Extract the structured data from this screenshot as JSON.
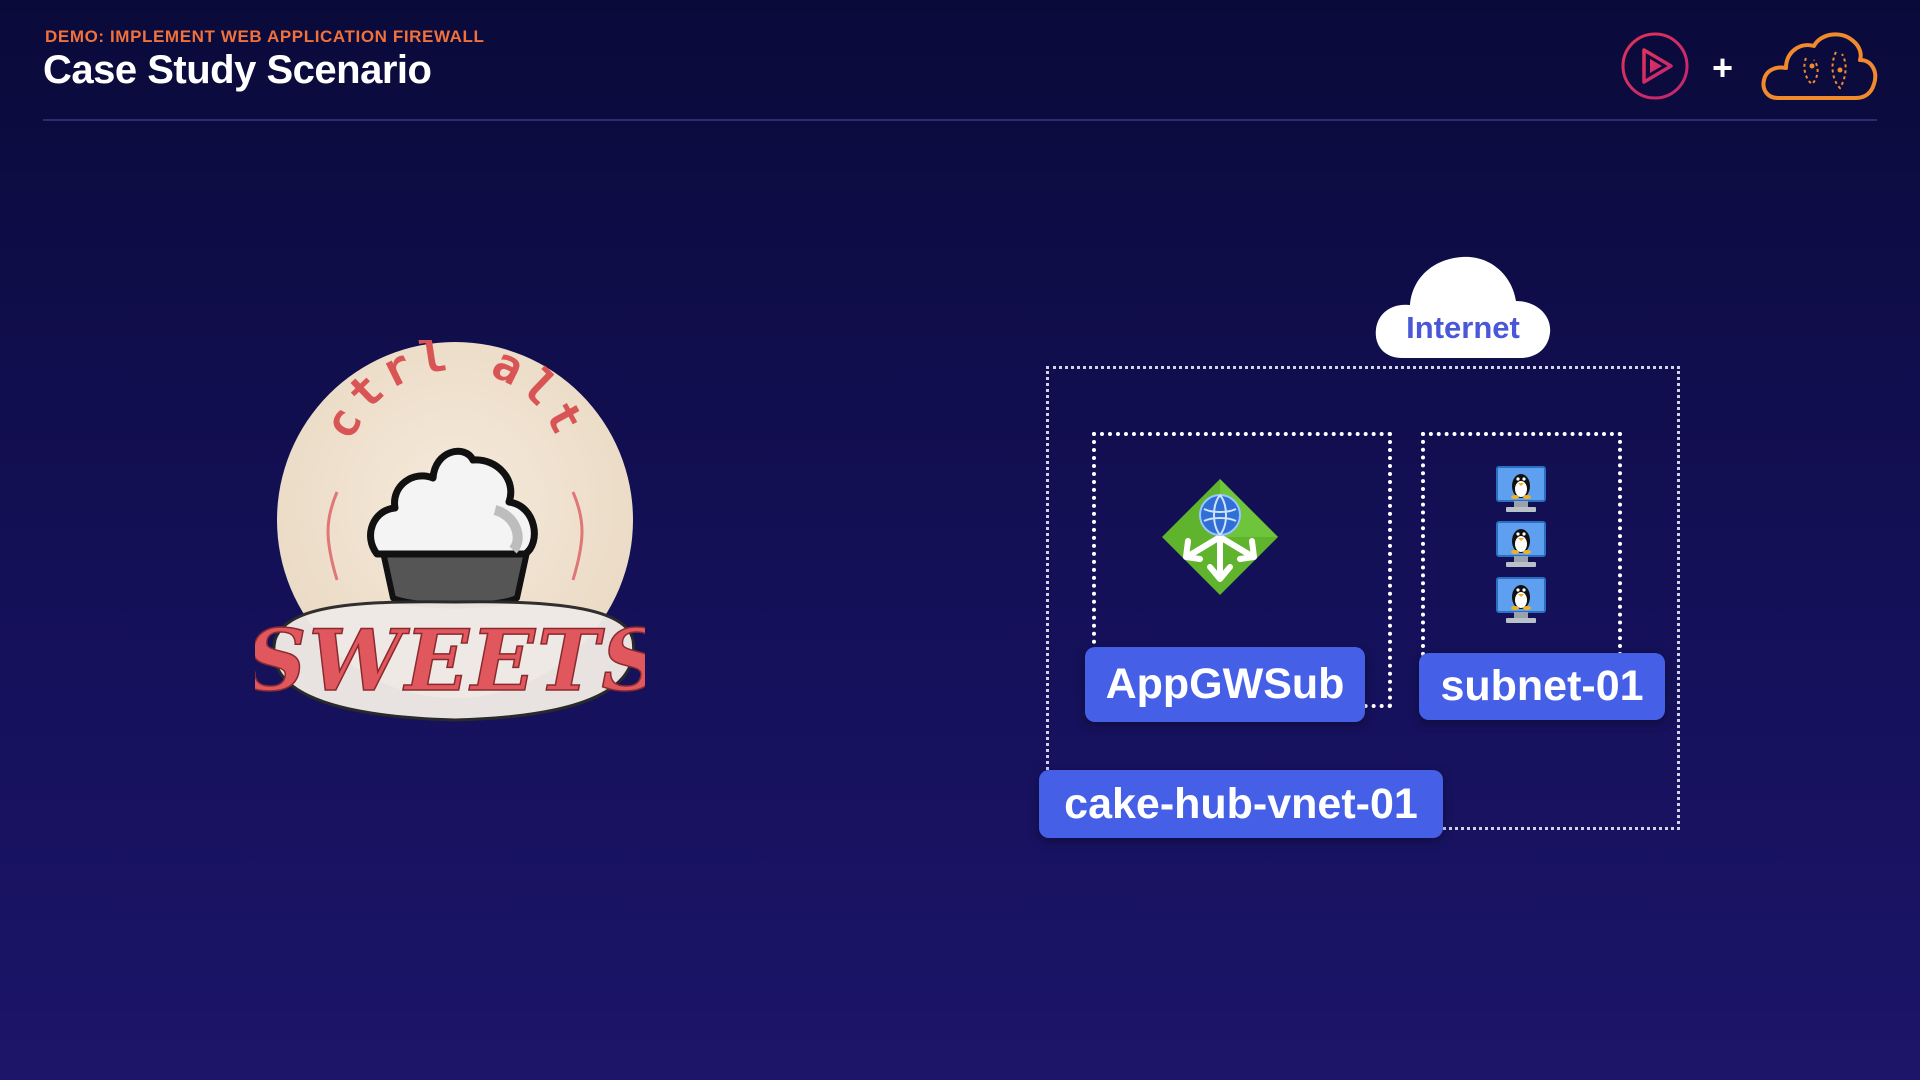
{
  "header": {
    "subtitle": "DEMO: IMPLEMENT WEB APPLICATION FIREWALL",
    "title": "Case Study Scenario",
    "plus_sign": "+"
  },
  "branding": {
    "left_logo": "play-icon",
    "right_logo": "cloud-icon",
    "accent_colors": [
      "#f0713a",
      "#e3325a"
    ]
  },
  "company_logo": {
    "top_text": "ctrl alt",
    "bottom_text": "SWEETS",
    "icon": "cupcake-icon"
  },
  "diagram": {
    "internet": {
      "label": "Internet"
    },
    "vnet": {
      "label": "cake-hub-vnet-01"
    },
    "subnets": [
      {
        "label": "AppGWSub",
        "resource_icon": "application-gateway-icon"
      },
      {
        "label": "subnet-01",
        "resource_icon": "linux-vm-icon",
        "vm_count": 3
      }
    ],
    "colors": {
      "label_bg": "#4560e6",
      "internet_text": "#4a58d8",
      "border": "#ffffff"
    }
  }
}
